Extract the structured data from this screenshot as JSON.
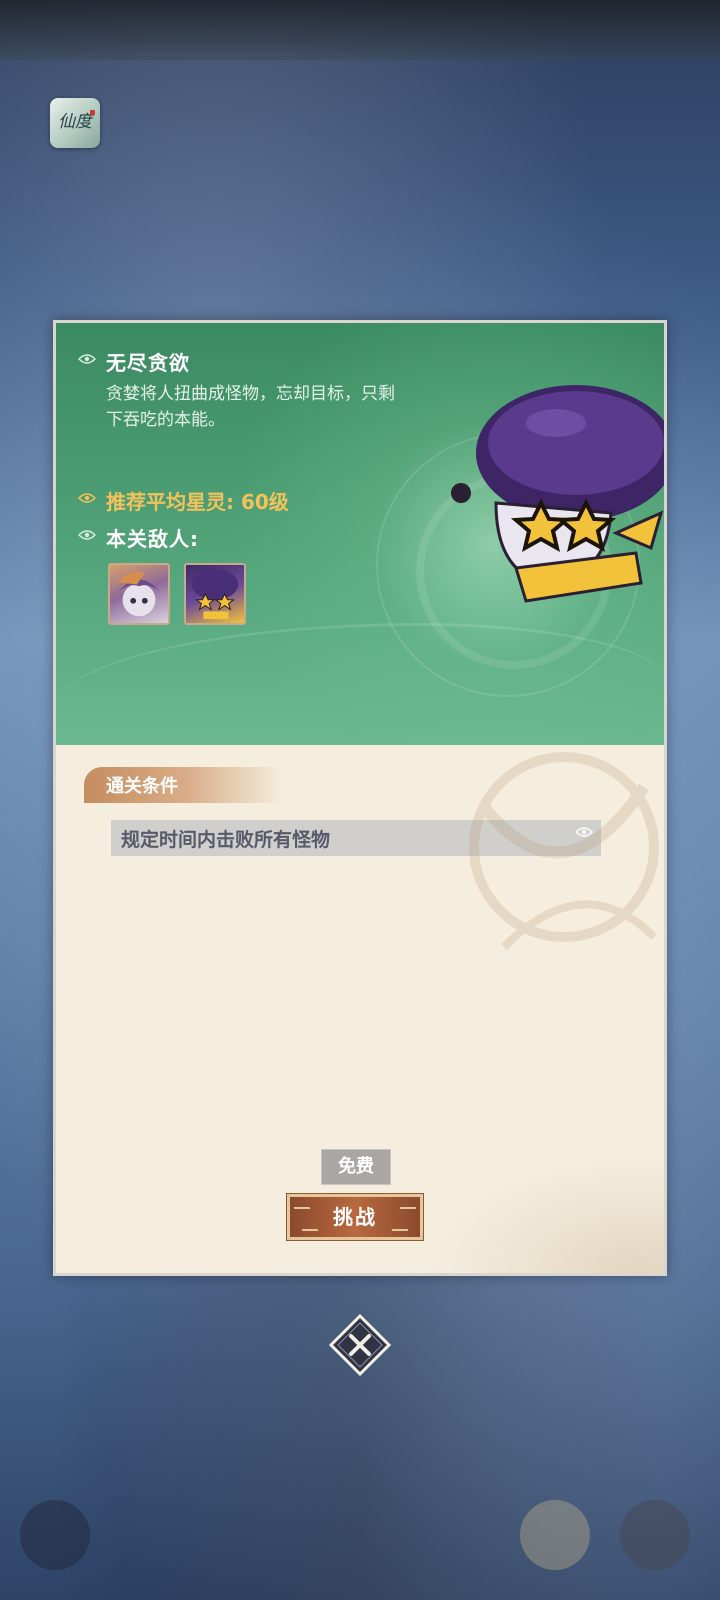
{
  "app_icon": {
    "label": "仙度"
  },
  "stage": {
    "title": "无尽贪欲",
    "description": "贪婪将人扭曲成怪物，忘却目标，只剩下吞吃的本能。",
    "recommend": "推荐平均星灵: 60级",
    "enemies_label": "本关敌人:"
  },
  "clear_condition": {
    "tag": "通关条件",
    "text": "规定时间内击败所有怪物"
  },
  "cost_label": "免费",
  "challenge_label": "挑战",
  "icons": [
    "eye-icon",
    "close-icon"
  ],
  "colors": {
    "accent_gold": "#f3c25a",
    "button_brown": "#b8693f",
    "panel_bg": "#f5eedf"
  }
}
